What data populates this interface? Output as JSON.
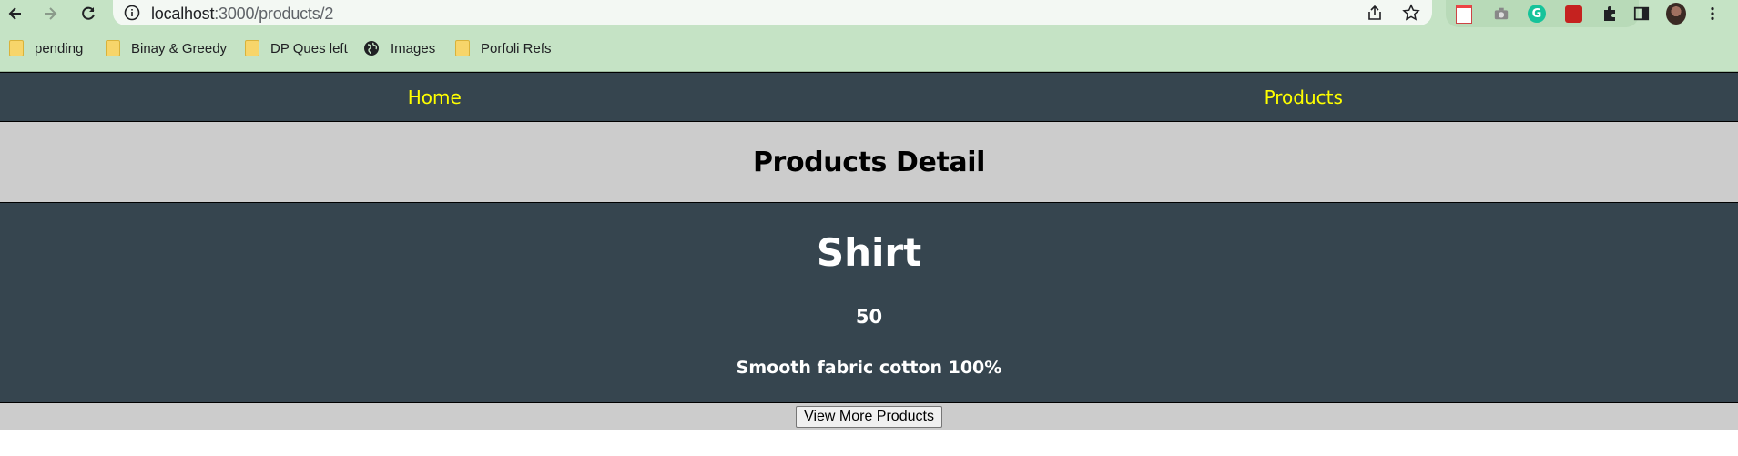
{
  "browser": {
    "url_host": "localhost",
    "url_path": ":3000/products/2",
    "bookmarks": [
      {
        "label": "pending",
        "icon": "folder-icon"
      },
      {
        "label": "Binay & Greedy",
        "icon": "folder-icon"
      },
      {
        "label": "DP Ques left",
        "icon": "folder-icon"
      },
      {
        "label": "Images",
        "icon": "globe-icon"
      },
      {
        "label": "Porfoli Refs",
        "icon": "folder-icon"
      }
    ]
  },
  "nav": {
    "home": "Home",
    "products": "Products",
    "link_color": "#ffff00",
    "background": "#36454f"
  },
  "page": {
    "heading": "Products Detail"
  },
  "product": {
    "name": "Shirt",
    "price": "50",
    "description": "Smooth fabric cotton 100%"
  },
  "actions": {
    "view_more": "View More Products"
  }
}
